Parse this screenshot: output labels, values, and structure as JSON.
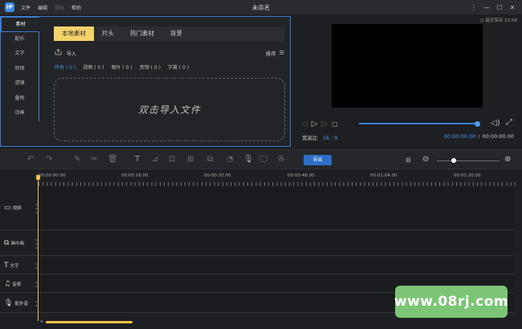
{
  "titlebar": {
    "logo": "IP",
    "menu": [
      "文件",
      "编辑",
      "导出",
      "帮助"
    ],
    "menu_dimmed": [
      false,
      false,
      true,
      false
    ],
    "title": "未命名",
    "controls": [
      "⋮",
      "—",
      "☐",
      "✕"
    ]
  },
  "sidebar": {
    "items": [
      "素材",
      "配乐",
      "文字",
      "转场",
      "滤镜",
      "叠附",
      "动画"
    ]
  },
  "media": {
    "tabs": [
      "本地素材",
      "片头",
      "热门素材",
      "背景"
    ],
    "import_label": "导入",
    "sort_label": "排序",
    "filters": [
      "所有 ( 0 )",
      "视频 ( 0 )",
      "图片 ( 0 )",
      "音频 ( 0 )",
      "字幕 ( 0 )"
    ],
    "dropzone_text": "双击导入文件"
  },
  "preview": {
    "autosave": "最近保存 23:58",
    "ratio_label": "宽高比",
    "ratio_value": "16 : 9",
    "current_time": "00:00:00.00",
    "separator": "/",
    "total_time": "00:00:00.00",
    "progress": 1.0
  },
  "toolbar": {
    "export_label": "导出",
    "zoom_level": 0.25
  },
  "timeline": {
    "ruler_labels": [
      "00:00:00.00",
      "00:00:16.00",
      "00:00:32.00",
      "00:00:48.00",
      "00:01:04.00",
      "00:01:20.00"
    ],
    "tracks": [
      {
        "name": "视频",
        "icon": "video-icon"
      },
      {
        "name": "画中画",
        "icon": "pip-icon"
      },
      {
        "name": "文字",
        "icon": "text-icon"
      },
      {
        "name": "音频",
        "icon": "music-icon"
      },
      {
        "name": "配外音",
        "icon": "mic-icon"
      }
    ]
  },
  "watermark": {
    "text": "www.08rj.com",
    "color": "#7cc576"
  },
  "colors": {
    "accent": "#3a7bd5",
    "tab_active": "#f5d26c",
    "playhead": "#f0c24a",
    "export_button": "#2d6fc7"
  }
}
